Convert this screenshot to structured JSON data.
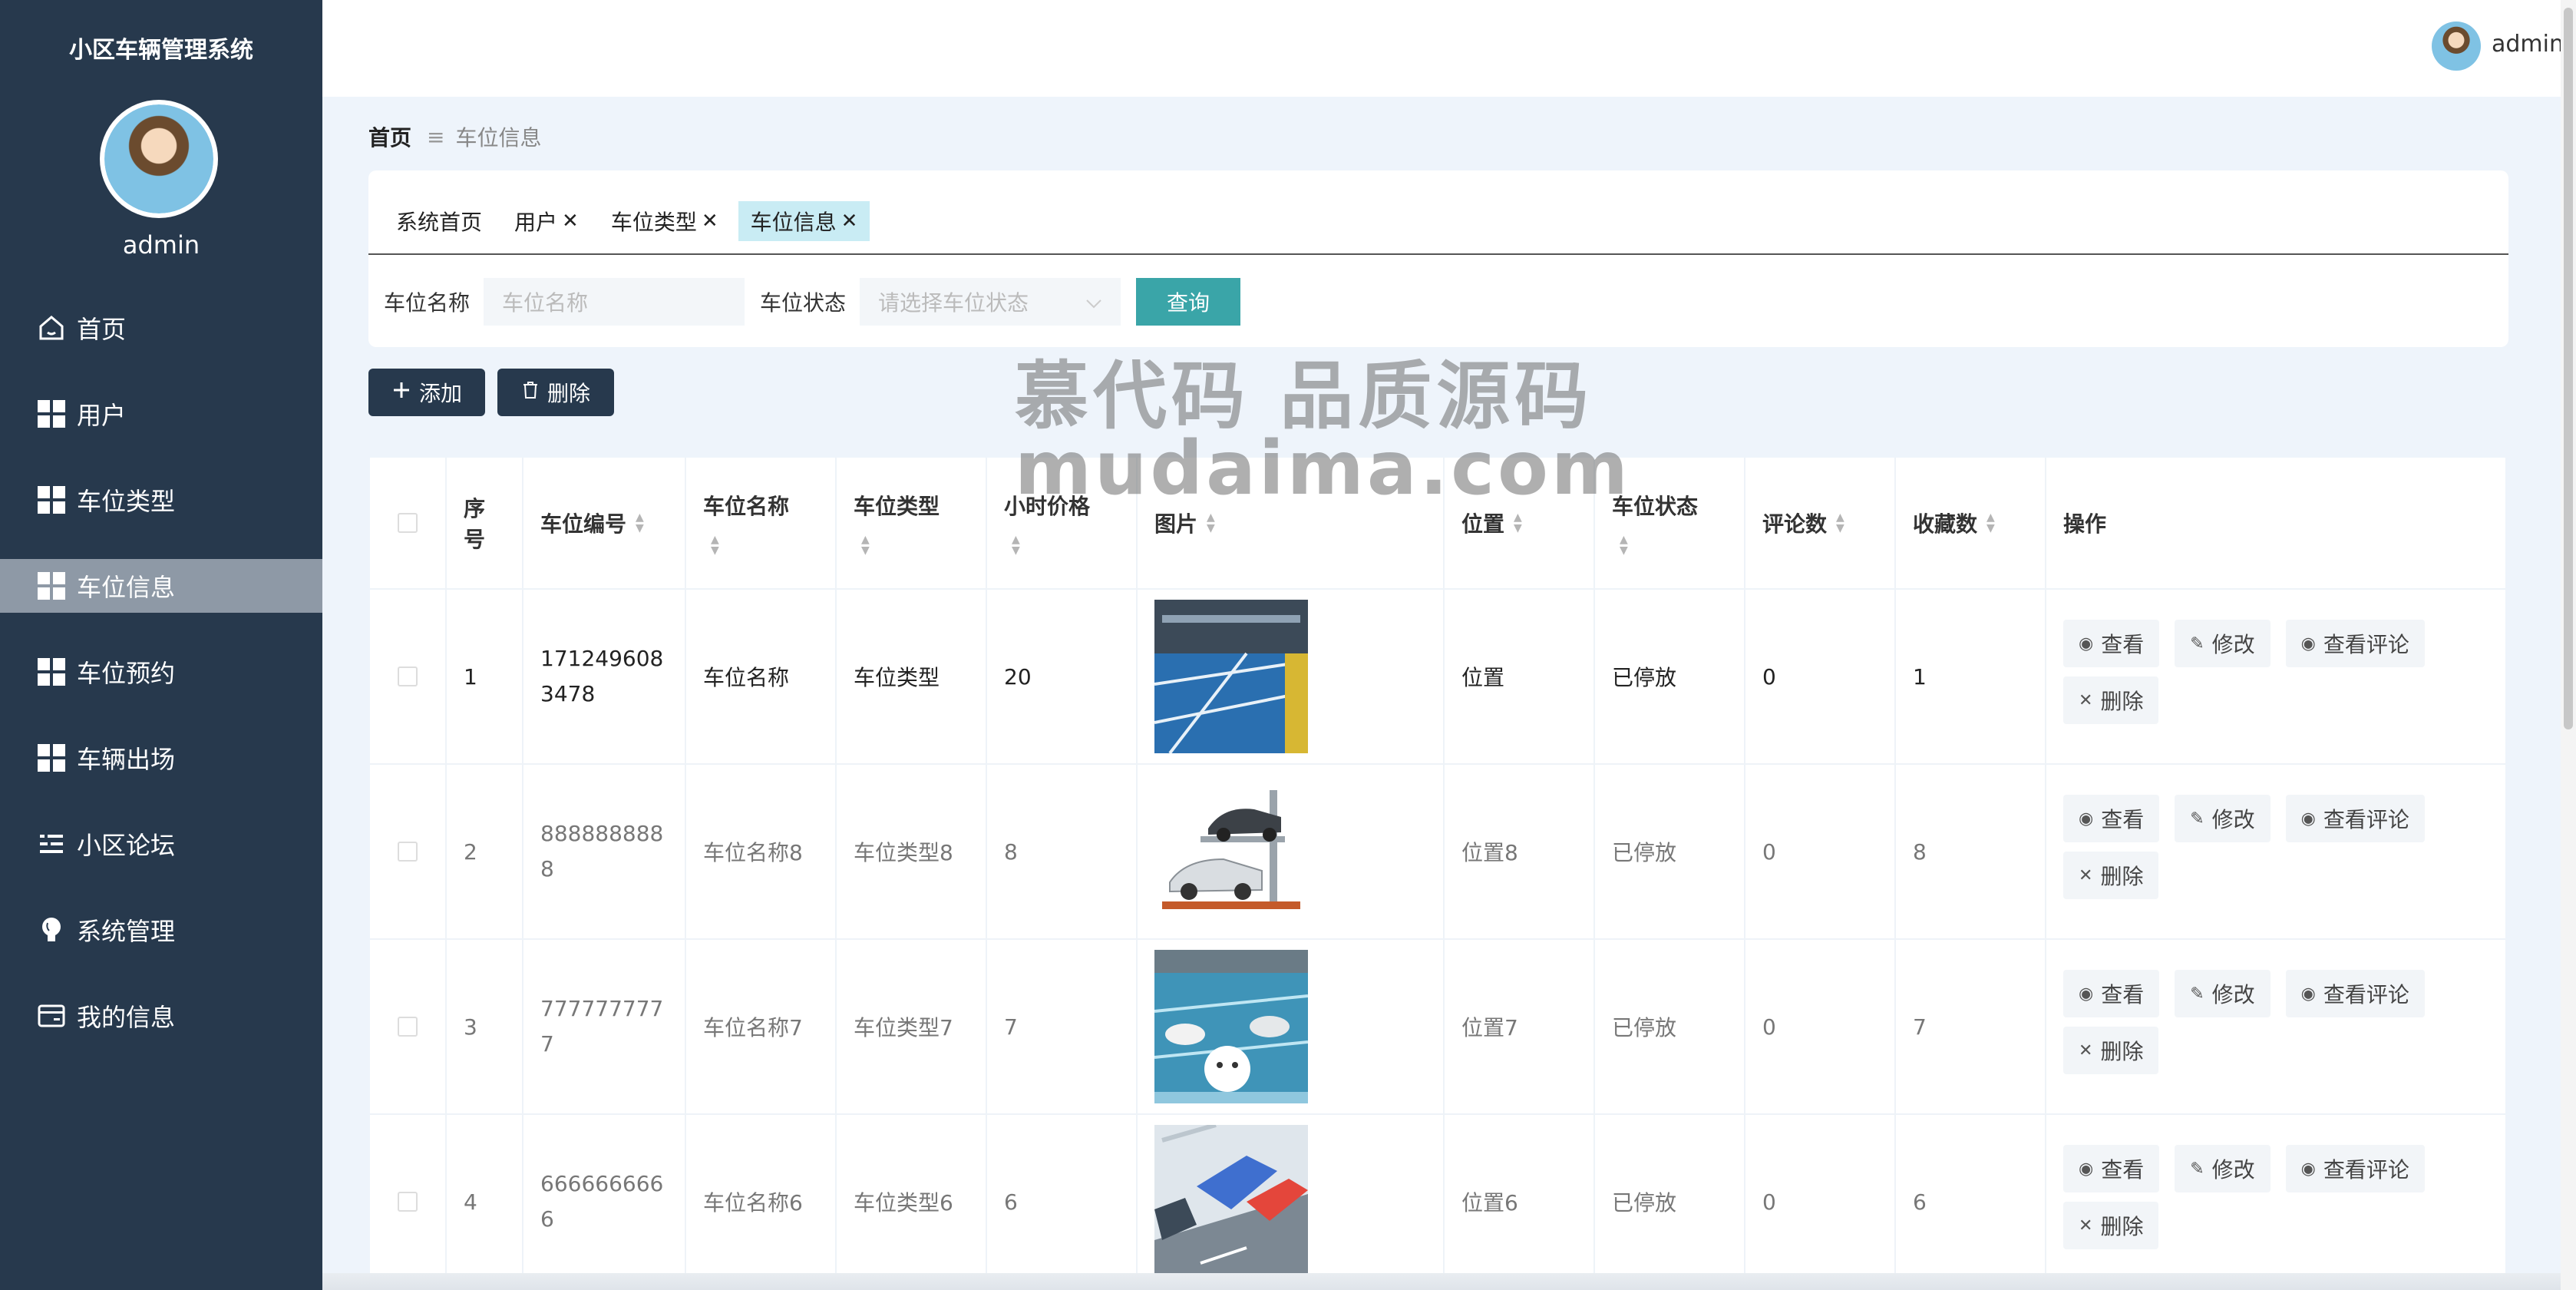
{
  "sidebar": {
    "app_title": "小区车辆管理系统",
    "username": "admin",
    "items": [
      {
        "label": "首页",
        "icon": "home-icon"
      },
      {
        "label": "用户",
        "icon": "grid-icon"
      },
      {
        "label": "车位类型",
        "icon": "grid-icon"
      },
      {
        "label": "车位信息",
        "icon": "grid-icon",
        "active": true
      },
      {
        "label": "车位预约",
        "icon": "grid-icon"
      },
      {
        "label": "车辆出场",
        "icon": "grid-icon"
      },
      {
        "label": "小区论坛",
        "icon": "list-icon"
      },
      {
        "label": "系统管理",
        "icon": "bulb-icon"
      },
      {
        "label": "我的信息",
        "icon": "card-icon"
      }
    ]
  },
  "header": {
    "username": "admin"
  },
  "breadcrumb": {
    "home": "首页",
    "separator": "≡",
    "current": "车位信息"
  },
  "tabs": [
    {
      "label": "系统首页",
      "closable": false
    },
    {
      "label": "用户",
      "closable": true
    },
    {
      "label": "车位类型",
      "closable": true
    },
    {
      "label": "车位信息",
      "closable": true,
      "active": true
    }
  ],
  "tab_close_glyph": "✕",
  "search": {
    "name_label": "车位名称",
    "name_placeholder": "车位名称",
    "status_label": "车位状态",
    "status_placeholder": "请选择车位状态",
    "query_button": "查询"
  },
  "actions": {
    "add": "添加",
    "delete": "删除"
  },
  "watermark": {
    "line1": "慕代码 品质源码",
    "line2": "mudaima.com"
  },
  "table": {
    "headers": {
      "index": "序号",
      "code": "车位编号",
      "name": "车位名称",
      "type": "车位类型",
      "price": "小时价格",
      "image": "图片",
      "location": "位置",
      "status": "车位状态",
      "comments": "评论数",
      "favorites": "收藏数",
      "ops": "操作"
    },
    "ops": {
      "view": "查看",
      "edit": "修改",
      "view_comments": "查看评论",
      "delete": "删除"
    },
    "rows": [
      {
        "index": "1",
        "code": "1712496083478",
        "name": "车位名称",
        "type": "车位类型",
        "price": "20",
        "image": "garage-photo",
        "location": "位置",
        "status": "已停放",
        "comments": "0",
        "favorites": "1"
      },
      {
        "index": "2",
        "code": "8888888888",
        "name": "车位名称8",
        "type": "车位类型8",
        "price": "8",
        "image": "lift-parking-photo",
        "location": "位置8",
        "status": "已停放",
        "comments": "0",
        "favorites": "8"
      },
      {
        "index": "3",
        "code": "7777777777",
        "name": "车位名称7",
        "type": "车位类型7",
        "price": "7",
        "image": "parking-illustration",
        "location": "位置7",
        "status": "已停放",
        "comments": "0",
        "favorites": "7"
      },
      {
        "index": "4",
        "code": "6666666666",
        "name": "车位名称6",
        "type": "车位类型6",
        "price": "6",
        "image": "cars-illustration",
        "location": "位置6",
        "status": "已停放",
        "comments": "0",
        "favorites": "6"
      }
    ]
  },
  "colors": {
    "sidebar": "#27394d",
    "accent": "#3aa5a8",
    "active_tab": "#c9ecf4",
    "active_menu": "#8e99a6"
  }
}
